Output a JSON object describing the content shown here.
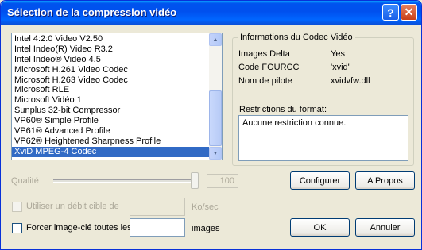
{
  "window": {
    "title": "Sélection de la compression vidéo",
    "help_glyph": "?",
    "close_glyph": "✕"
  },
  "codec_list": {
    "items": [
      "Intel 4:2:0 Video V2.50",
      "Intel Indeo(R) Video R3.2",
      "Intel Indeo® Video 4.5",
      "Microsoft H.261 Video Codec",
      "Microsoft H.263 Video Codec",
      "Microsoft RLE",
      "Microsoft Vidéo 1",
      "Sunplus 32-bit Compressor",
      "VP60® Simple Profile",
      "VP61® Advanced Profile",
      "VP62® Heightened Sharpness Profile",
      "XviD MPEG-4 Codec"
    ],
    "selected_index": 11,
    "scroll_up_icon": "▲",
    "scroll_down_icon": "▼"
  },
  "codec_info": {
    "group_title": "Informations du Codec Vidéo",
    "rows": [
      {
        "label": "Images Delta",
        "value": "Yes"
      },
      {
        "label": "Code FOURCC",
        "value": "'xvid'"
      },
      {
        "label": "Nom de pilote",
        "value": "xvidvfw.dll"
      }
    ],
    "restrictions_label": "Restrictions du format:",
    "restrictions_text": "Aucune restriction connue."
  },
  "quality": {
    "label": "Qualité",
    "value": "100",
    "level": 1.0
  },
  "bitrate": {
    "label": "Utiliser un débit cible de",
    "unit": "Ko/sec",
    "value": "",
    "checked": false,
    "enabled": false
  },
  "keyframe": {
    "label": "Forcer image-clé toutes les",
    "unit": "images",
    "value": "",
    "checked": false
  },
  "buttons": {
    "configure": "Configurer",
    "about": "A Propos",
    "ok": "OK",
    "cancel": "Annuler"
  },
  "colors": {
    "title_bar": "#0053ee",
    "selection": "#316ac5",
    "dialog_bg": "#ece9d8"
  }
}
